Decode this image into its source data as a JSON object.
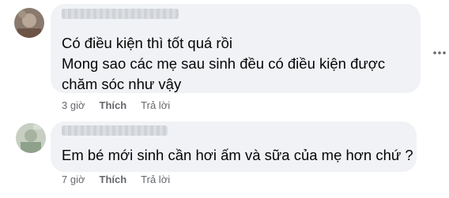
{
  "comments": [
    {
      "lines": [
        "Có điều kiện thì tốt quá rồi",
        "Mong sao các mẹ sau sinh đều có điều kiện được",
        "chăm sóc như vậy"
      ],
      "time": "3 giờ",
      "like_label": "Thích",
      "reply_label": "Trả lời"
    },
    {
      "lines": [
        "Em bé mới sinh cần hơi ấm và sữa của mẹ hơn chứ ?"
      ],
      "time": "7 giờ",
      "like_label": "Thích",
      "reply_label": "Trả lời"
    }
  ],
  "icons": {
    "more": "more-horizontal-icon"
  }
}
